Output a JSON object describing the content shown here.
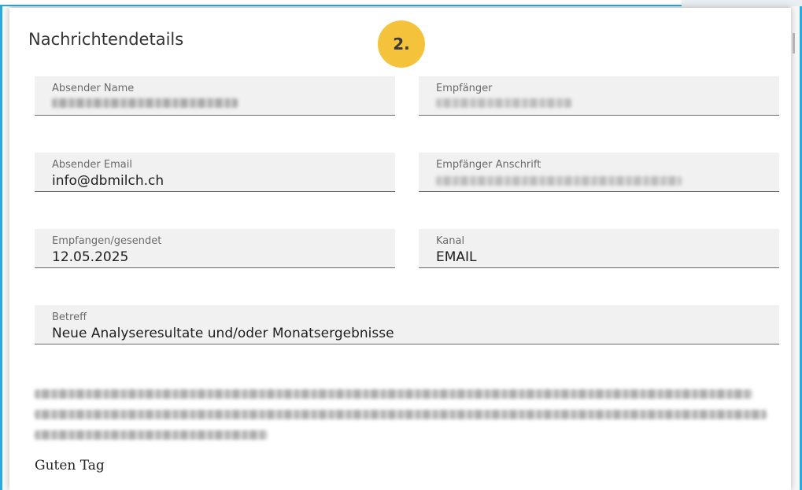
{
  "modal": {
    "title": "Nachrichtendetails",
    "step_badge": "2."
  },
  "fields": {
    "sender_name": {
      "label": "Absender Name",
      "value": ""
    },
    "recipient": {
      "label": "Empfänger",
      "value": ""
    },
    "sender_email": {
      "label": "Absender Email",
      "value": "info@dbmilch.ch"
    },
    "recipient_address": {
      "label": "Empfänger Anschrift",
      "value": ""
    },
    "received_sent": {
      "label": "Empfangen/gesendet",
      "value": "12.05.2025"
    },
    "channel": {
      "label": "Kanal",
      "value": "EMAIL"
    },
    "subject": {
      "label": "Betreff",
      "value": "Neue Analyseresultate und/oder Monatsergebnisse"
    }
  },
  "message": {
    "greeting": "Guten Tag"
  },
  "colors": {
    "accent": "#2aa9e0",
    "badge": "#f5c33b",
    "field_background": "#f1f1f1"
  }
}
